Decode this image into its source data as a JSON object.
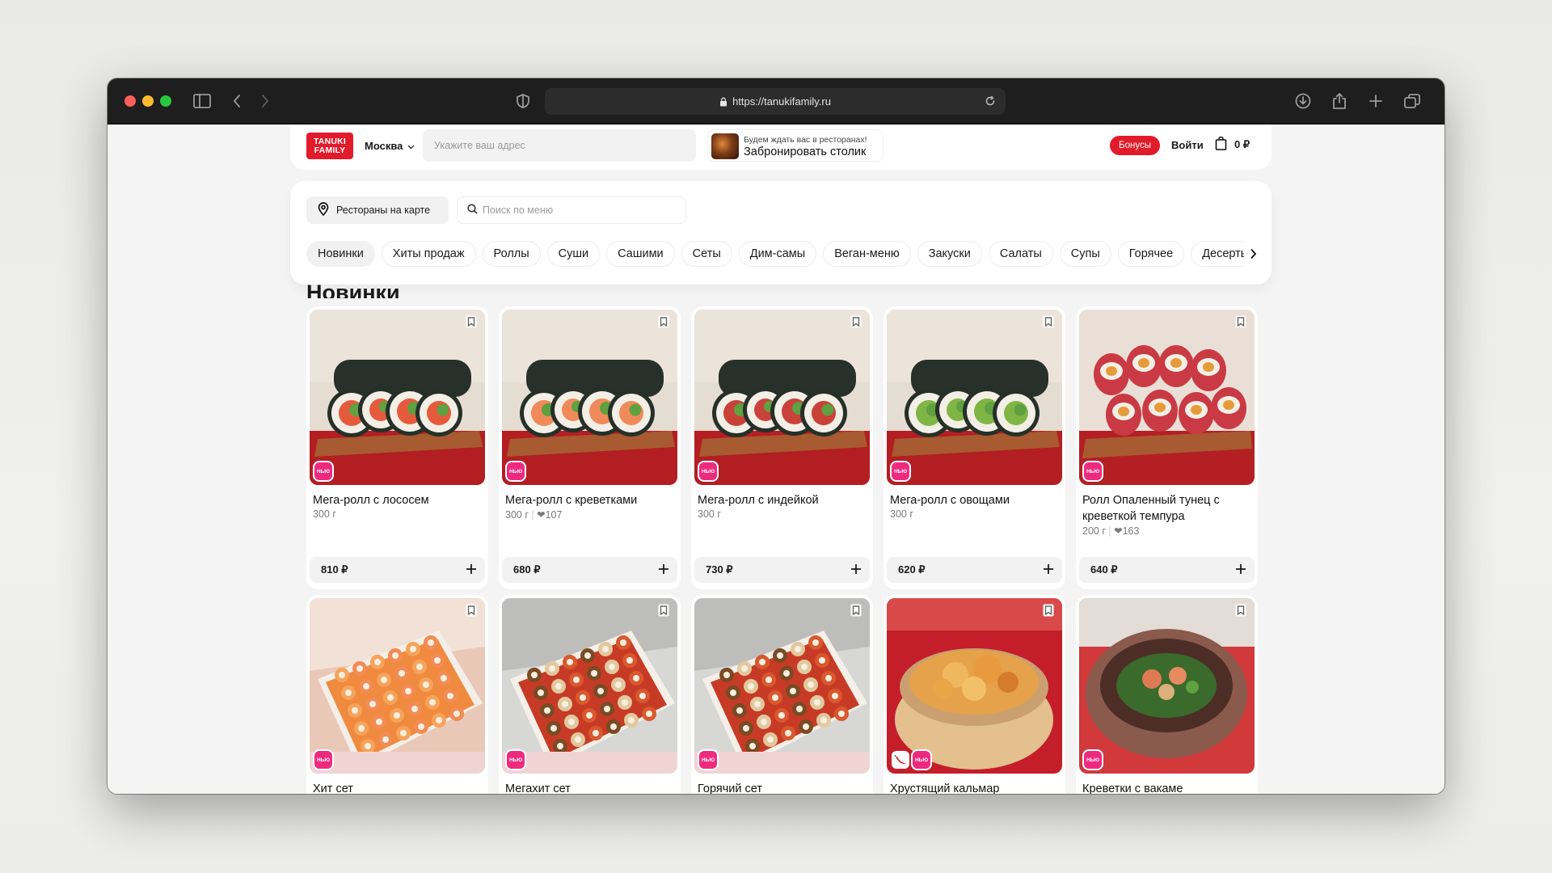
{
  "browser": {
    "url": "https://tanukifamily.ru"
  },
  "header": {
    "logo_line1": "TANUKI",
    "logo_line2": "FAMILY",
    "city": "Москва",
    "address_placeholder": "Укажите ваш адрес",
    "reserve_small": "Будем ждать вас в ресторанах!",
    "reserve_big": "Забронировать столик",
    "bonus_label": "Бонусы",
    "login_label": "Войти",
    "cart_total": "0 ₽"
  },
  "panel": {
    "map_button": "Рестораны на карте",
    "search_placeholder": "Поиск по меню",
    "categories": [
      "Новинки",
      "Хиты продаж",
      "Роллы",
      "Суши",
      "Сашими",
      "Сеты",
      "Дим-самы",
      "Веган-меню",
      "Закуски",
      "Салаты",
      "Супы",
      "Горячее",
      "Десерты"
    ]
  },
  "section_title": "Новинки",
  "badge_new_label": "НЬЮ",
  "products": [
    {
      "name": "Мега-ролл с лососем",
      "weight": "300 г",
      "likes": "",
      "price": "810 ₽",
      "spicy": false,
      "image": "roll-salmon"
    },
    {
      "name": "Мега-ролл с креветками",
      "weight": "300 г",
      "likes": "107",
      "price": "680 ₽",
      "spicy": false,
      "image": "roll-shrimp"
    },
    {
      "name": "Мега-ролл с индейкой",
      "weight": "300 г",
      "likes": "",
      "price": "730 ₽",
      "spicy": false,
      "image": "roll-turkey"
    },
    {
      "name": "Мега-ролл с овощами",
      "weight": "300 г",
      "likes": "",
      "price": "620 ₽",
      "spicy": false,
      "image": "roll-veggie"
    },
    {
      "name": "Ролл Опаленный тунец с креветкой темпура",
      "weight": "200 г",
      "likes": "163",
      "price": "640 ₽",
      "spicy": false,
      "image": "roll-tuna"
    },
    {
      "name": "Хит сет",
      "weight": "",
      "likes": "",
      "price": "",
      "spicy": false,
      "image": "set-hit"
    },
    {
      "name": "Мегахит сет",
      "weight": "",
      "likes": "",
      "price": "",
      "spicy": false,
      "image": "set-megahit"
    },
    {
      "name": "Горячий сет",
      "weight": "",
      "likes": "",
      "price": "",
      "spicy": false,
      "image": "set-hot"
    },
    {
      "name": "Хрустящий кальмар",
      "weight": "",
      "likes": "",
      "price": "",
      "spicy": true,
      "image": "squid-bowl"
    },
    {
      "name": "Креветки с вакаме",
      "weight": "",
      "likes": "",
      "price": "",
      "spicy": false,
      "image": "shrimp-wakame-bowl"
    }
  ],
  "colors": {
    "brand_red": "#e21b2b",
    "badge_pink": "#ee2a7f"
  }
}
